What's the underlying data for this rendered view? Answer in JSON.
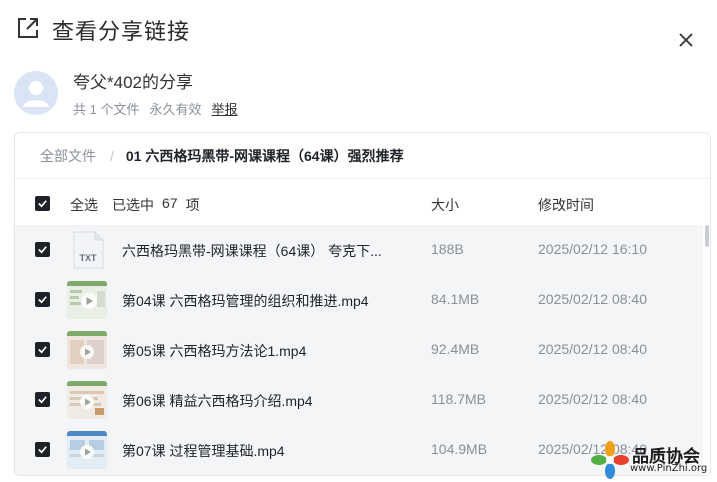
{
  "dialog": {
    "title": "查看分享链接"
  },
  "sharer": {
    "name": "夸父*402的分享",
    "file_count": "共 1 个文件",
    "validity": "永久有效",
    "report": "举报"
  },
  "breadcrumb": {
    "root": "全部文件",
    "separator": "/",
    "current": "01 六西格玛黑带-网课课程（64课）强烈推荐"
  },
  "list_header": {
    "select_all": "全选",
    "selected_prefix": "已选中",
    "selected_count": "67",
    "selected_suffix": "项",
    "size": "大小",
    "modified": "修改时间"
  },
  "files": [
    {
      "name": "六西格玛黑带-网课课程（64课） 夸克下...",
      "size": "188B",
      "time": "2025/02/12 16:10",
      "icon": "txt-file-icon",
      "checked": true
    },
    {
      "name": "第04课 六西格玛管理的组织和推进.mp4",
      "size": "84.1MB",
      "time": "2025/02/12 08:40",
      "icon": "video-thumbnail",
      "checked": true
    },
    {
      "name": "第05课 六西格玛方法论1.mp4",
      "size": "92.4MB",
      "time": "2025/02/12 08:40",
      "icon": "video-thumbnail",
      "checked": true
    },
    {
      "name": "第06课 精益六西格玛介绍.mp4",
      "size": "118.7MB",
      "time": "2025/02/12 08:40",
      "icon": "video-thumbnail",
      "checked": true
    },
    {
      "name": "第07课 过程管理基础.mp4",
      "size": "104.9MB",
      "time": "2025/02/12 08:40",
      "icon": "video-thumbnail",
      "checked": true
    }
  ],
  "watermark": {
    "title": "品质协会",
    "url": "www.PinZhi.org"
  },
  "colors": {
    "checkbox": "#1f2329",
    "row_background": "#f4f5f7",
    "muted_text": "#8a8f99"
  }
}
